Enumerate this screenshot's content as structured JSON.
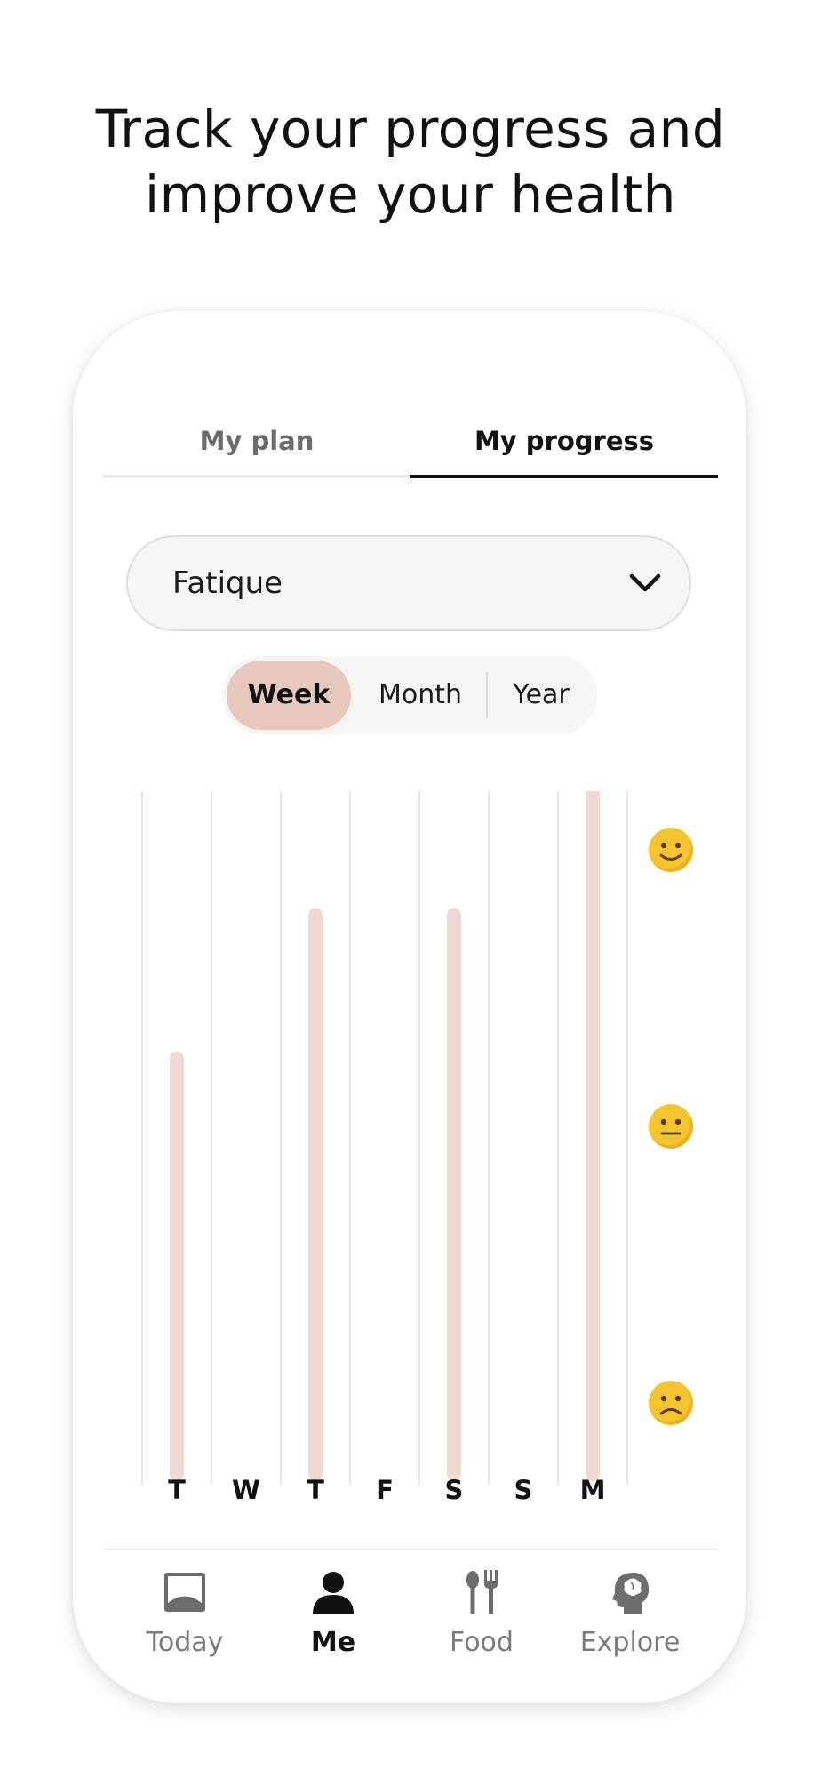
{
  "headline": {
    "line1": "Track your progress and",
    "line2": "improve your health"
  },
  "tabs": [
    {
      "label": "My plan",
      "selected": false
    },
    {
      "label": "My progress",
      "selected": true
    }
  ],
  "symptom_select": {
    "value": "Fatique",
    "icon": "chevron-down-icon"
  },
  "range_toggle": [
    {
      "label": "Week",
      "selected": true
    },
    {
      "label": "Month",
      "selected": false
    },
    {
      "label": "Year",
      "selected": false
    }
  ],
  "chart_data": {
    "type": "bar",
    "categories": [
      "T",
      "W",
      "T",
      "F",
      "S",
      "S",
      "M"
    ],
    "values": [
      1.2,
      null,
      1.72,
      null,
      1.72,
      null,
      2.22
    ],
    "ylim": [
      0,
      2
    ],
    "y_markers": [
      {
        "value": 2,
        "icon": "slightly-smiling-face-icon"
      },
      {
        "value": 1,
        "icon": "neutral-face-icon"
      },
      {
        "value": 0,
        "icon": "slightly-frowning-face-icon"
      }
    ],
    "bar_color": "#f0d9d2",
    "grid": true
  },
  "bottom_nav": [
    {
      "label": "Today",
      "icon": "today-icon",
      "active": false
    },
    {
      "label": "Me",
      "icon": "person-icon",
      "active": true
    },
    {
      "label": "Food",
      "icon": "fork-spoon-icon",
      "active": false
    },
    {
      "label": "Explore",
      "icon": "head-brain-icon",
      "active": false
    }
  ],
  "colors": {
    "accent": "#e8c8bd",
    "text": "#111111",
    "muted": "#7a7a7a"
  }
}
